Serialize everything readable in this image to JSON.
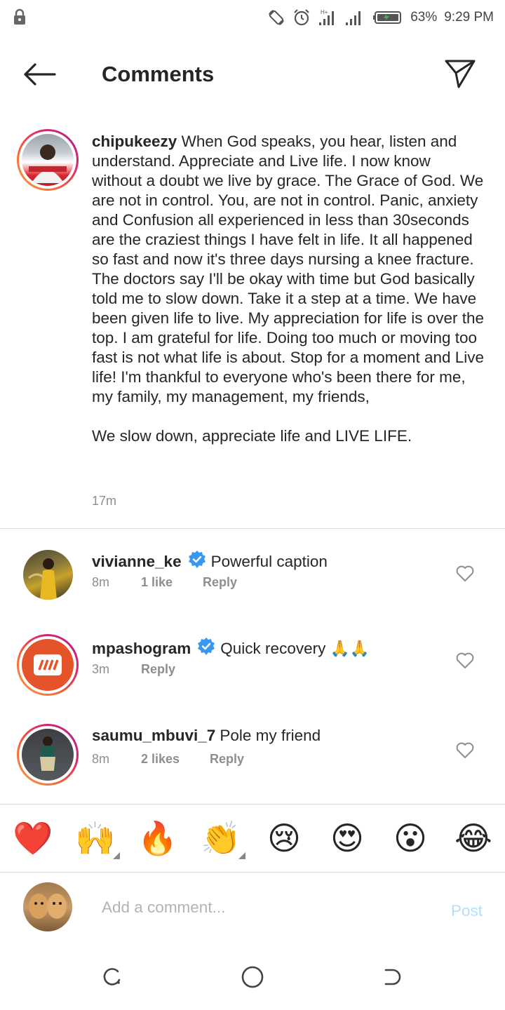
{
  "status_bar": {
    "battery": "63%",
    "time": "9:29 PM",
    "icons": [
      "lock-icon",
      "auto-rotate-icon",
      "alarm-icon",
      "signal-icon",
      "signal-icon",
      "battery-icon"
    ]
  },
  "header": {
    "title": "Comments",
    "back_icon": "arrow-left-icon",
    "send_icon": "paper-plane-icon"
  },
  "caption": {
    "username": "chipukeezy",
    "text_1": "When God speaks, you hear, listen and understand. Appreciate and Live life. I now know without a doubt we live by grace. The Grace of God. We are not in control. You, are not in control. Panic, anxiety and Confusion all experienced in less than 30seconds are the craziest things I have felt in life. It all happened so fast and now it's three days nursing a knee fracture. The doctors say I'll be okay with time but God basically told me to slow down. Take it a step at a time. We have been given life to live. My appreciation for life is over the top. I am grateful for life. Doing too much or moving too fast is not what life is about. Stop for a moment and Live life! I'm thankful to everyone who's been there for me, my family, my management, my friends,",
    "text_2": "We slow down, appreciate life and LIVE LIFE.",
    "time": "17m"
  },
  "comments": [
    {
      "username": "vivianne_ke",
      "verified": true,
      "text": "Powerful caption",
      "time": "8m",
      "likes": "1 like",
      "reply": "Reply"
    },
    {
      "username": "mpashogram",
      "verified": true,
      "text": "Quick recovery 🙏🙏",
      "time": "3m",
      "likes": "",
      "reply": "Reply"
    },
    {
      "username": "saumu_mbuvi_7",
      "verified": false,
      "text": "Pole my friend",
      "time": "8m",
      "likes": "2 likes",
      "reply": "Reply"
    }
  ],
  "emoji_bar": [
    "❤️",
    "🙌",
    "🔥",
    "👏",
    "😢",
    "😍",
    "😮",
    "😂"
  ],
  "composer": {
    "placeholder": "Add a comment...",
    "post_label": "Post"
  },
  "colors": {
    "text": "#262626",
    "secondary": "#8e8e8e",
    "verified_blue": "#3897f0",
    "post_disabled": "#b2dffc",
    "divider": "#dbdbdb"
  }
}
